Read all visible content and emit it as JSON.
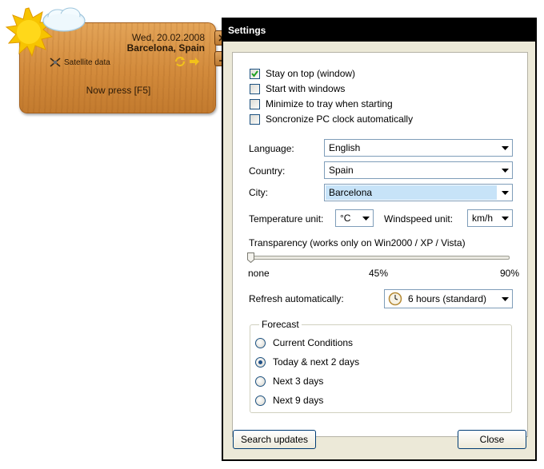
{
  "widget": {
    "date": "Wed, 20.02.2008",
    "city": "Barcelona, Spain",
    "satellite_label": "Satellite data",
    "prompt": "Now press [F5]",
    "weather_icon": "sun-cloud-icon",
    "colors": {
      "wood": "#d28a3b",
      "arrow": "#f2c21a"
    }
  },
  "settings": {
    "title": "Settings",
    "checkboxes": [
      {
        "label": "Stay on top (window)",
        "checked": true
      },
      {
        "label": "Start with windows",
        "checked": false
      },
      {
        "label": "Minimize to tray when starting",
        "checked": false
      },
      {
        "label": "Soncronize PC clock automatically",
        "checked": false
      }
    ],
    "language": {
      "label": "Language:",
      "value": "English"
    },
    "country": {
      "label": "Country:",
      "value": "Spain"
    },
    "city": {
      "label": "City:",
      "value": "Barcelona"
    },
    "temperature": {
      "label": "Temperature unit:",
      "value": "°C"
    },
    "windspeed": {
      "label": "Windspeed unit:",
      "value": "km/h"
    },
    "transparency": {
      "label": "Transparency (works only on Win2000 / XP / Vista)",
      "min_label": "none",
      "mid_label": "45%",
      "max_label": "90%",
      "value_percent": 0
    },
    "refresh": {
      "label": "Refresh automatically:",
      "value": "6 hours (standard)",
      "icon": "clock-icon"
    },
    "forecast": {
      "legend": "Forecast",
      "options": [
        {
          "label": "Current Conditions",
          "selected": false
        },
        {
          "label": "Today & next 2 days",
          "selected": true
        },
        {
          "label": "Next 3 days",
          "selected": false
        },
        {
          "label": "Next 9 days",
          "selected": false
        }
      ]
    },
    "buttons": {
      "search": "Search updates",
      "close": "Close"
    }
  }
}
